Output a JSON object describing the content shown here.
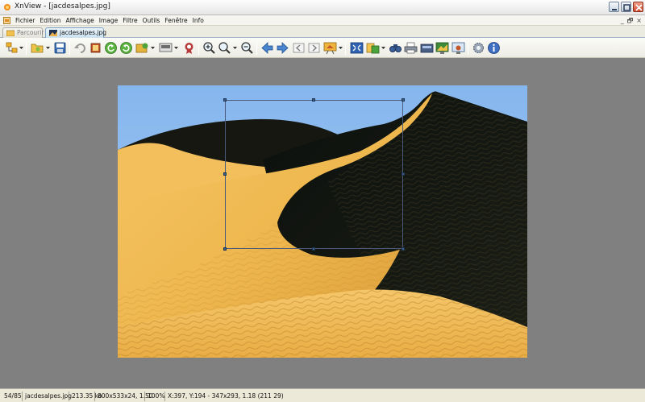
{
  "window": {
    "title": "XnView - [jacdesalpes.jpg]"
  },
  "menu": {
    "items": [
      "Fichier",
      "Edition",
      "Affichage",
      "Image",
      "Filtre",
      "Outils",
      "Fenêtre",
      "Info"
    ],
    "mdi_minimize": "_",
    "mdi_restore": "🗗",
    "mdi_close": "×"
  },
  "tabs": [
    {
      "label": "Parcourir",
      "active": false
    },
    {
      "label": "jacdesalpes.jpg",
      "active": true
    }
  ],
  "toolbar": {
    "icons": [
      "browser-icon",
      "open-folder-icon",
      "save-icon",
      "undo-icon",
      "crop-icon",
      "rotate-left-icon",
      "rotate-right-icon",
      "adjust-icon",
      "screen-icon",
      "color-icon",
      "zoom-in-icon",
      "zoom-icon",
      "zoom-out-icon",
      "previous-icon",
      "next-icon",
      "first-icon",
      "last-icon",
      "slideshow-icon",
      "fullscreen-icon",
      "convert-icon",
      "find-icon",
      "print-icon",
      "scanner-icon",
      "wallpaper-icon",
      "capture-icon",
      "settings-icon",
      "info-icon"
    ]
  },
  "image": {
    "filename": "jacdesalpes.jpg",
    "sky_color": "#8fbdf2",
    "sand_light": "#f2bf5c",
    "sand_shadow": "#111511"
  },
  "statusbar": {
    "position": "54/85",
    "filename": "jacdesalpes.jpg",
    "filesize": "213.35 ko",
    "dimensions": "800x533x24, 1.50",
    "zoom": "100%",
    "selection_info": "X:397, Y:194 - 347x293, 1.18 (211 29)"
  }
}
